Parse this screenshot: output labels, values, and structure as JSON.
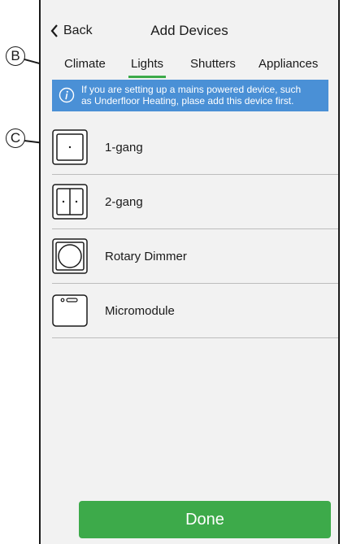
{
  "header": {
    "back_label": "Back",
    "title": "Add Devices"
  },
  "tabs": [
    {
      "label": "Climate",
      "active": false
    },
    {
      "label": "Lights",
      "active": true
    },
    {
      "label": "Shutters",
      "active": false
    },
    {
      "label": "Appliances",
      "active": false
    }
  ],
  "info_banner": {
    "line1": "If you are setting up a mains powered device, such",
    "line2": "as Underfloor Heating, plase add this device first.",
    "icon": "info-icon"
  },
  "devices": [
    {
      "label": "1-gang",
      "icon": "1-gang-switch-icon"
    },
    {
      "label": "2-gang",
      "icon": "2-gang-switch-icon"
    },
    {
      "label": "Rotary Dimmer",
      "icon": "rotary-dimmer-icon"
    },
    {
      "label": "Micromodule",
      "icon": "micromodule-icon"
    }
  ],
  "done_label": "Done",
  "callouts": {
    "b": "B",
    "c": "C"
  },
  "colors": {
    "accent_green": "#3daa4a",
    "info_blue": "#4a90d6",
    "background": "#f2f2f2"
  }
}
